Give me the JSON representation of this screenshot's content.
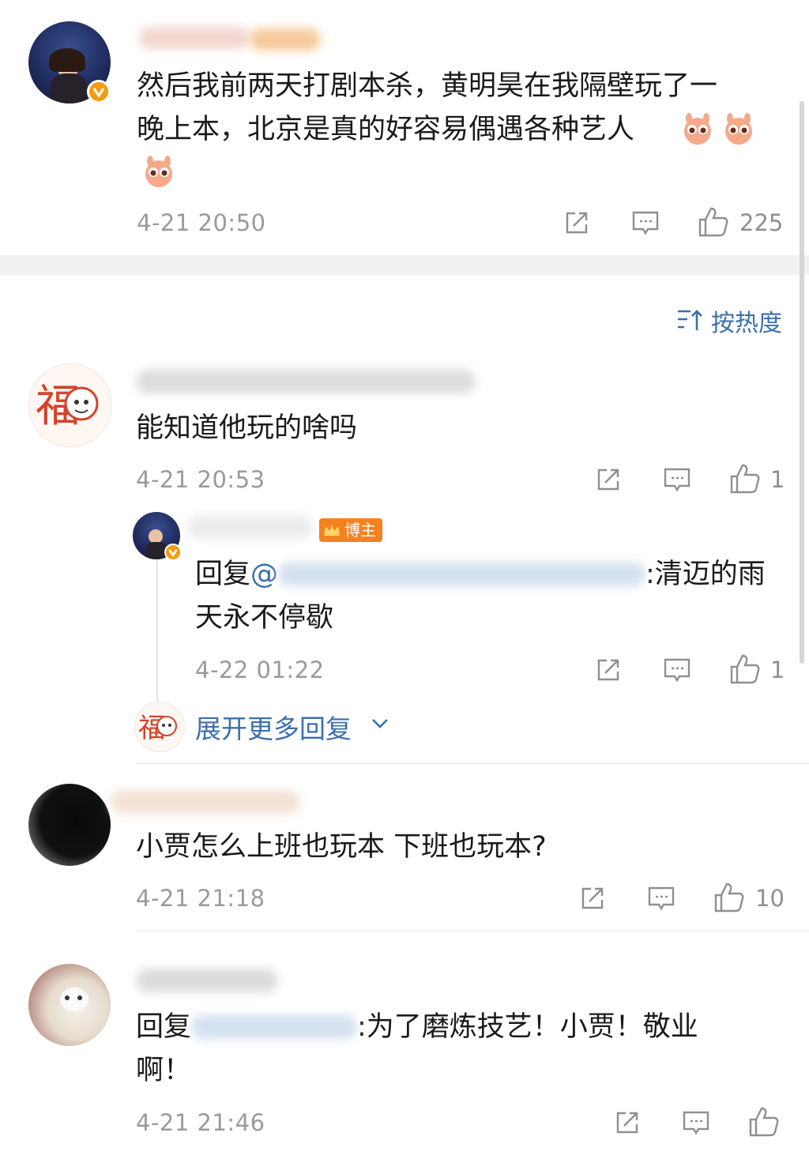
{
  "colors": {
    "link": "#3b6fae",
    "muted": "#9a9a9a",
    "badge_orange": "#f39c12"
  },
  "post": {
    "text_line1": "然后我前两天打剧本杀，黄明昊在我隔壁玩了一",
    "text_line2": "晚上本，北京是真的好容易偶遇各种艺人",
    "time": "4-21 20:50",
    "like_count": "225"
  },
  "sort_label": "按热度",
  "comments": [
    {
      "text": "能知道他玩的啥吗",
      "time": "4-21 20:53",
      "like_count": "1",
      "reply": {
        "badge": "博主",
        "prefix": "回复",
        "at": "@",
        "suffix": ":清迈的雨",
        "line2": "天永不停歇",
        "time": "4-22 01:22",
        "like_count": "1"
      },
      "more_replies": "展开更多回复"
    },
    {
      "text": "小贾怎么上班也玩本 下班也玩本?",
      "time": "4-21 21:18",
      "like_count": "10"
    },
    {
      "prefix": "回复",
      "suffix": ":为了磨炼技艺！小贾！敬业",
      "line2": "啊！",
      "time": "4-21 21:46"
    }
  ]
}
